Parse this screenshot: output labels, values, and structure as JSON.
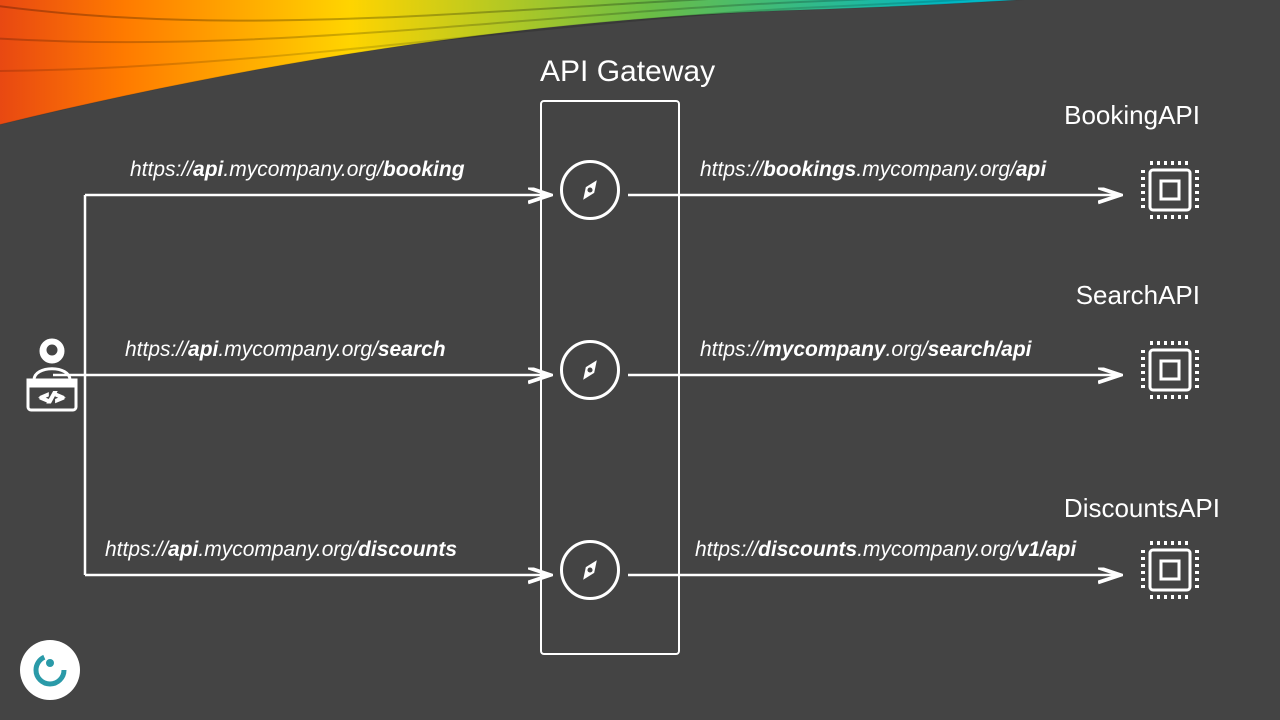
{
  "gateway_title": "API Gateway",
  "apis": {
    "booking": {
      "label": "BookingAPI"
    },
    "search": {
      "label": "SearchAPI"
    },
    "discounts": {
      "label": "DiscountsAPI"
    }
  },
  "urls": {
    "booking_in_pre": "https://",
    "booking_in_b1": "api",
    "booking_in_mid": ".mycompany.org/",
    "booking_in_b2": "booking",
    "search_in_pre": "https://",
    "search_in_b1": "api",
    "search_in_mid": ".mycompany.org/",
    "search_in_b2": "search",
    "discounts_in_pre": "https://",
    "discounts_in_b1": "api",
    "discounts_in_mid": ".mycompany.org/",
    "discounts_in_b2": "discounts",
    "booking_out_pre": "https://",
    "booking_out_b1": "bookings",
    "booking_out_mid": ".mycompany.org/",
    "booking_out_b2": "api",
    "search_out_pre": "https://",
    "search_out_b1": "mycompany",
    "search_out_mid": ".org/",
    "search_out_b2": "search/api",
    "discounts_out_pre": "https://",
    "discounts_out_b1": "discounts",
    "discounts_out_mid": ".mycompany.org/",
    "discounts_out_b2": "v1/api"
  }
}
